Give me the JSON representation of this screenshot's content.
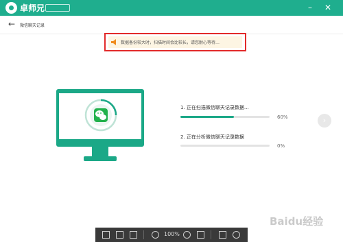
{
  "app": {
    "name": "卓师兄",
    "badge": ""
  },
  "window": {
    "minimize_icon": "minimize-icon",
    "close_icon": "close-icon"
  },
  "header": {
    "back_label": "微信聊天记录"
  },
  "notice": {
    "text": "数据备份较大时，扫描时间会比较长，请您耐心等待…"
  },
  "progress": {
    "tasks": [
      {
        "label": "1. 正在扫描微信聊天记录数据…",
        "percent_text": "60%",
        "percent": 60
      },
      {
        "label": "2. 正在分析微信聊天记录数据",
        "percent_text": "0%",
        "percent": 0
      }
    ]
  },
  "viewer_toolbar": {
    "zoom": "100%"
  },
  "watermark": {
    "text": "Baidu经验"
  },
  "colors": {
    "brand": "#1fae8e",
    "accent": "#1ba887",
    "notice_border": "#e22a2a",
    "notice_bg": "#fdf5e3"
  }
}
